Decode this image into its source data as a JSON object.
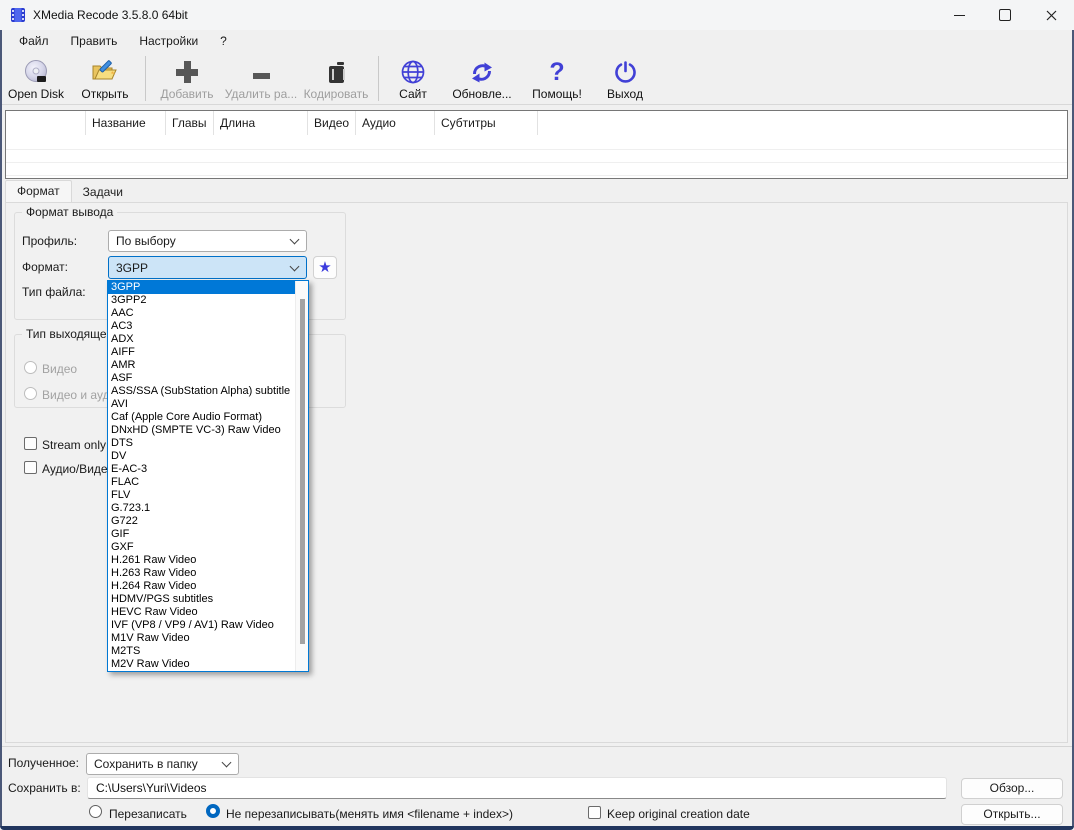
{
  "window": {
    "title": "XMedia Recode 3.5.8.0 64bit"
  },
  "menu": {
    "items": [
      {
        "label": "Файл"
      },
      {
        "label": "Править"
      },
      {
        "label": "Настройки"
      },
      {
        "label": "?"
      }
    ]
  },
  "toolbar": {
    "buttons": [
      {
        "label": "Open Disk",
        "icon": "open-disc-icon",
        "state": "enabled"
      },
      {
        "label": "Открыть",
        "icon": "open-folder-icon",
        "state": "enabled"
      },
      {
        "label": "Добавить",
        "icon": "plus-icon",
        "state": "disabled"
      },
      {
        "label": "Удалить ра...",
        "icon": "minus-icon",
        "state": "disabled"
      },
      {
        "label": "Кодировать",
        "icon": "encode-icon",
        "state": "disabled"
      },
      {
        "label": "Сайт",
        "icon": "globe-icon",
        "state": "enabled"
      },
      {
        "label": "Обновле...",
        "icon": "refresh-icon",
        "state": "enabled"
      },
      {
        "label": "Помощь!",
        "icon": "question-icon",
        "state": "enabled"
      },
      {
        "label": "Выход",
        "icon": "power-icon",
        "state": "enabled"
      }
    ]
  },
  "file_table": {
    "columns": [
      "",
      "Название",
      "Главы",
      "Длина",
      "Видео",
      "Аудио",
      "Субтитры"
    ]
  },
  "tabs": [
    {
      "label": "Формат",
      "active": true
    },
    {
      "label": "Задачи",
      "active": false
    }
  ],
  "format_section": {
    "group_title": "Формат вывода",
    "profile_label": "Профиль:",
    "profile_value": "По выбору",
    "format_label": "Формат:",
    "format_value": "3GPP",
    "filetype_label": "Тип файла:",
    "output_type_group_title": "Тип выходящего",
    "radio_video": "Видео",
    "radio_video_audio": "Видео и ауди",
    "check_stream_only": "Stream only co",
    "check_audio_video": "Аудио/Видео"
  },
  "format_dropdown": {
    "selected": "3GPP",
    "items": [
      "3GPP",
      "3GPP2",
      "AAC",
      "AC3",
      "ADX",
      "AIFF",
      "AMR",
      "ASF",
      "ASS/SSA (SubStation Alpha) subtitle",
      "AVI",
      "Caf (Apple Core Audio Format)",
      "DNxHD (SMPTE VC-3) Raw Video",
      "DTS",
      "DV",
      "E-AC-3",
      "FLAC",
      "FLV",
      "G.723.1",
      "G722",
      "GIF",
      "GXF",
      "H.261 Raw Video",
      "H.263 Raw Video",
      "H.264 Raw Video",
      "HDMV/PGS subtitles",
      "HEVC Raw Video",
      "IVF (VP8 / VP9 / AV1) Raw Video",
      "M1V Raw Video",
      "M2TS",
      "M2V Raw Video"
    ]
  },
  "bottom": {
    "output_label": "Полученное:",
    "output_mode_value": "Сохранить в папку",
    "save_to_label": "Сохранить в:",
    "save_path": "C:\\Users\\Yuri\\Videos",
    "browse_button": "Обзор...",
    "open_button": "Открыть...",
    "radio_overwrite": "Перезаписать",
    "radio_no_overwrite": "Не перезаписывать(менять имя <filename + index>)",
    "check_keep_date": "Keep original creation date"
  },
  "icons": {
    "star": "★",
    "question": "?"
  },
  "colors": {
    "accent": "#0078d4",
    "selection": "#0078d7",
    "toolbar_icon_blue": "#4140d6",
    "window_bg": "#f0f0f0"
  }
}
